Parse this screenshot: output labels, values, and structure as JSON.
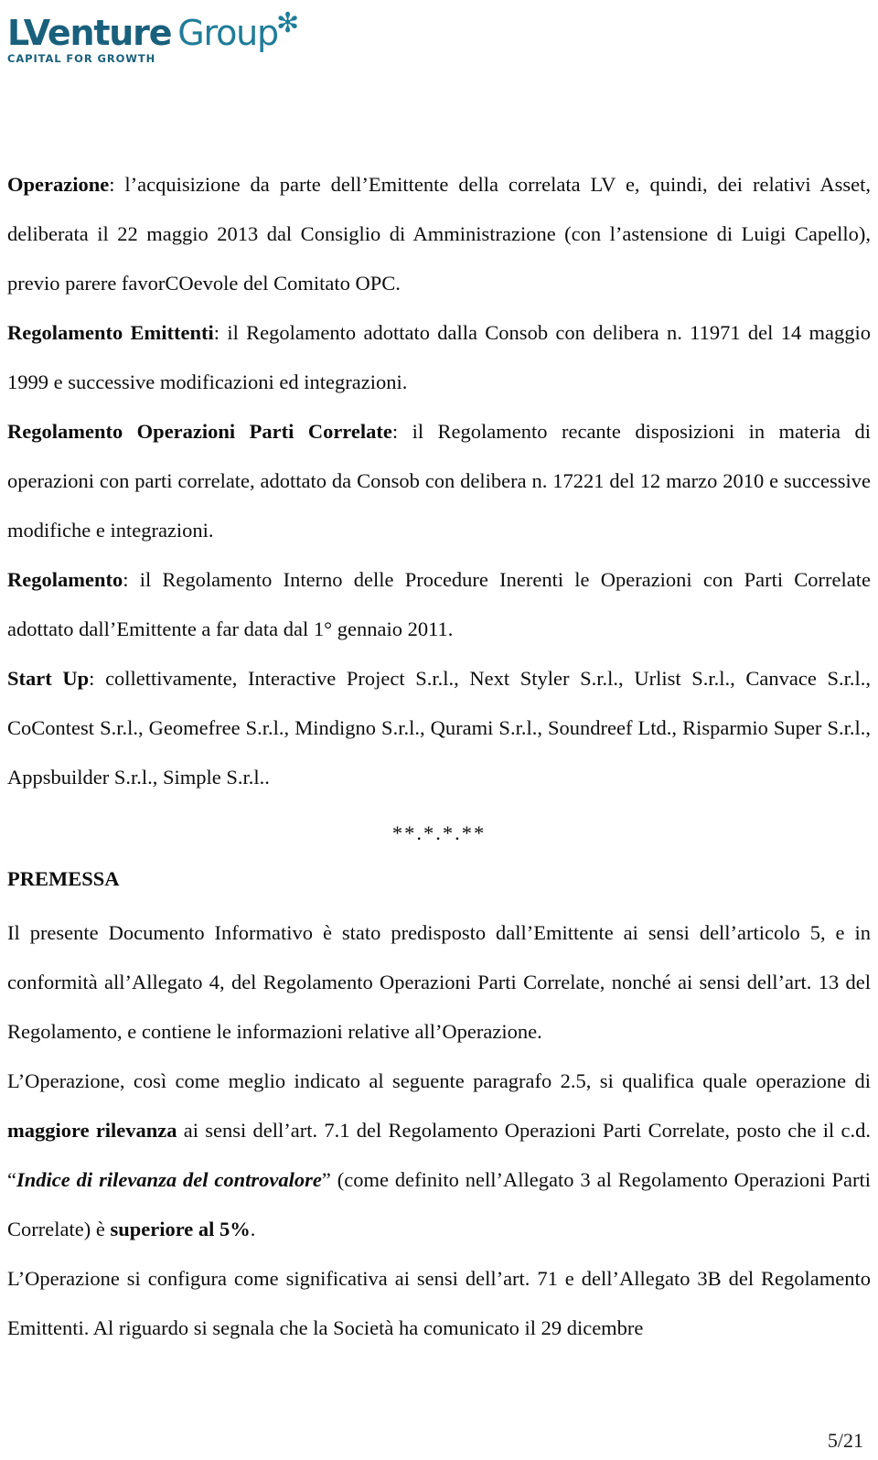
{
  "logo": {
    "name_bold": "LVenture",
    "name_light": "Group",
    "star": "✻",
    "tagline": "CAPITAL FOR GROWTH",
    "color_dark": "#19607c",
    "color_light": "#1f7c99"
  },
  "document": {
    "definitions": [
      {
        "term": "Operazione",
        "separator": ": ",
        "text": "l’acquisizione da parte dell’Emittente della correlata LV e, quindi, dei relativi Asset, deliberata il 22 maggio 2013 dal Consiglio di Amministrazione (con l’astensione di Luigi Capello), previo parere favorCOevole del Comitato OPC."
      },
      {
        "term": "Regolamento Emittenti",
        "separator": ": ",
        "text": "il Regolamento adottato dalla Consob con delibera n. 11971 del 14 maggio 1999 e successive modificazioni ed integrazioni."
      },
      {
        "term": "Regolamento Operazioni Parti Correlate",
        "separator": ": ",
        "text": "il Regolamento recante disposizioni in materia di operazioni con parti correlate, adottato da Consob con delibera n. 17221 del 12 marzo 2010 e successive modifiche e integrazioni."
      },
      {
        "term": "Regolamento",
        "separator": ": ",
        "text": "il Regolamento Interno delle Procedure Inerenti le Operazioni con Parti Correlate adottato dall’Emittente a far data dal 1° gennaio 2011."
      },
      {
        "term": "Start Up",
        "separator": ": ",
        "text": "collettivamente, Interactive Project S.r.l., Next Styler S.r.l., Urlist S.r.l., Canvace S.r.l., CoContest S.r.l., Geomefree S.r.l., Mindigno S.r.l., Qurami S.r.l., Soundreef Ltd., Risparmio Super S.r.l., Appsbuilder S.r.l., Simple S.r.l.."
      }
    ],
    "separator_marks": "**.*.*.**",
    "section_heading": "PREMESSA",
    "premessa_p1": "Il presente Documento Informativo è stato predisposto dall’Emittente ai sensi dell’articolo 5, e in conformità all’Allegato 4, del Regolamento Operazioni Parti Correlate, nonché ai sensi dell’art. 13 del Regolamento, e contiene le informazioni relative all’Operazione.",
    "premessa_p2": {
      "seg1": "L’Operazione, così come meglio indicato al seguente paragrafo 2.5, si qualifica quale operazione di ",
      "bold1": "maggiore rilevanza",
      "seg2": " ai sensi dell’art. 7.1 del Regolamento Operazioni Parti Correlate, posto che il c.d. “",
      "bolditalic1": "Indice di rilevanza del controvalore",
      "seg3": "” (come definito nell’Allegato 3 al Regolamento Operazioni Parti Correlate) è ",
      "bold2": "superiore al 5%",
      "seg4": "."
    },
    "premessa_p3": "L’Operazione si configura come significativa ai sensi dell’art. 71 e dell’Allegato 3B del Regolamento Emittenti. Al riguardo si segnala che la Società ha comunicato il 29 dicembre"
  },
  "footer": {
    "page_number": "5/21"
  }
}
